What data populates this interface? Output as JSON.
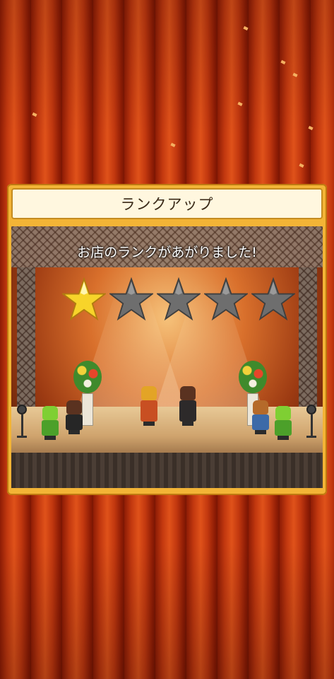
{
  "dialog": {
    "title": "ランクアップ",
    "message": "お店のランクがあがりました!"
  },
  "rank": {
    "stars_filled": 1,
    "stars_total": 5,
    "filled_color": "#f7d42a",
    "empty_color": "#6e6e6e"
  },
  "icons": {
    "star": "star-icon"
  },
  "colors": {
    "panel": "#f3b436",
    "title_bg": "#fff7df",
    "curtain": "#c2380f"
  }
}
